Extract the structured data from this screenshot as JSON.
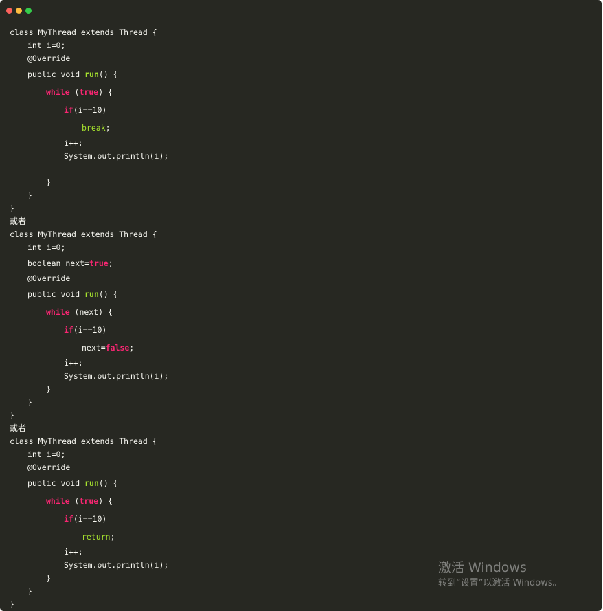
{
  "window": {
    "traffic_lights": {
      "close_color": "#fc625d",
      "minimize_color": "#fdbc40",
      "zoom_color": "#35cd4b"
    },
    "theme": {
      "background": "#272822",
      "text": "#f8f8f2",
      "keyword_pink": "#f92672",
      "keyword_green": "#a6e22e"
    }
  },
  "code": {
    "block1": {
      "class_decl": "class MyThread extends Thread {",
      "field_i": "int i=0;",
      "override": "@Override",
      "run_prefix": "public void ",
      "run_name": "run",
      "run_suffix": "() {",
      "while_kw": "while",
      "while_open": " (",
      "while_cond": "true",
      "while_close": ") {",
      "if_kw": "if",
      "if_cond": "(i==10)",
      "break_kw": "break",
      "break_semi": ";",
      "inc": "i++;",
      "println": "System.out.println(i);",
      "close_while": "}",
      "close_run": "}",
      "close_class": "}"
    },
    "separator1": "或者",
    "block2": {
      "class_decl": "class MyThread extends Thread {",
      "field_i": "int i=0;",
      "field_next_prefix": "boolean next=",
      "field_next_value": "true",
      "field_next_semi": ";",
      "override": "@Override",
      "run_prefix": "public void ",
      "run_name": "run",
      "run_suffix": "() {",
      "while_kw": "while",
      "while_rest": " (next) {",
      "if_kw": "if",
      "if_cond": "(i==10)",
      "assign_prefix": "next=",
      "assign_value": "false",
      "assign_semi": ";",
      "inc": "i++;",
      "println": "System.out.println(i);",
      "close_while": "}",
      "close_run": "}",
      "close_class": "}"
    },
    "separator2": "或者",
    "block3": {
      "class_decl": "class MyThread extends Thread {",
      "field_i": "int i=0;",
      "override": "@Override",
      "run_prefix": "public void ",
      "run_name": "run",
      "run_suffix": "() {",
      "while_kw": "while",
      "while_open": " (",
      "while_cond": "true",
      "while_close": ") {",
      "if_kw": "if",
      "if_cond": "(i==10)",
      "return_kw": "return",
      "return_semi": ";",
      "inc": "i++;",
      "println": "System.out.println(i);",
      "close_while": "}",
      "close_run": "}",
      "close_class": "}"
    }
  },
  "watermark": {
    "title": "激活 Windows",
    "subtitle": "转到“设置”以激活 Windows。"
  }
}
